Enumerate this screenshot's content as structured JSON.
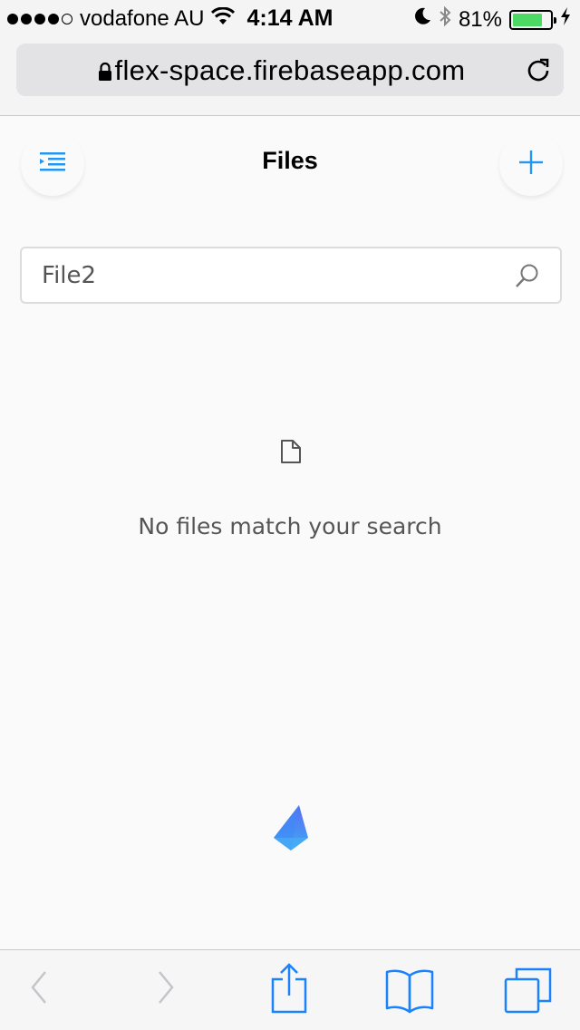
{
  "status_bar": {
    "carrier": "vodafone AU",
    "time": "4:14 AM",
    "battery_percent": "81%",
    "battery_level": 0.81,
    "signal_bars": 4,
    "signal_max": 5
  },
  "browser": {
    "url": "flex-space.firebaseapp.com"
  },
  "header": {
    "title": "Files"
  },
  "search": {
    "value": "File2"
  },
  "empty_state": {
    "message": "No files match your search"
  },
  "colors": {
    "accent": "#2196f3",
    "ios_blue": "#1a82fb",
    "battery_green": "#4cd964"
  },
  "icons": {
    "menu": "menu-indent-icon",
    "add": "plus-icon",
    "search": "magnifier-icon",
    "file": "document-icon",
    "logo": "firebase-logo"
  }
}
